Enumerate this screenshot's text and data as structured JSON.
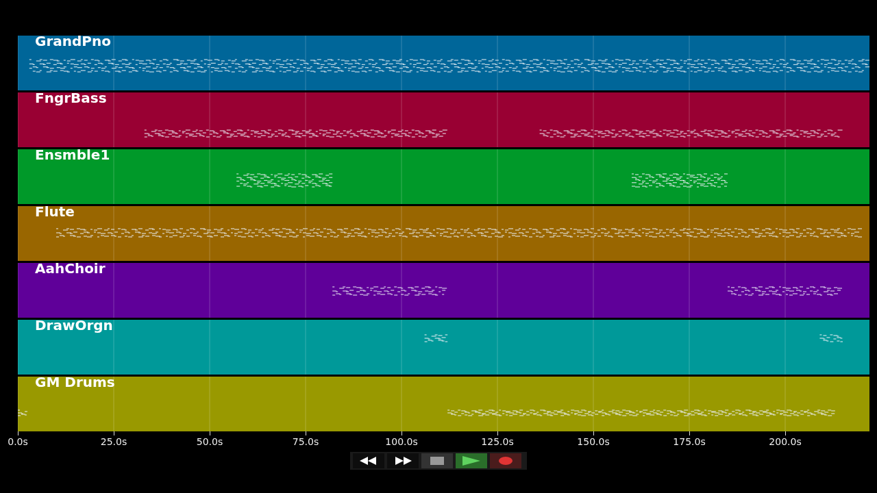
{
  "tracks": [
    {
      "name": "GrandPno",
      "color": "#006699"
    },
    {
      "name": "FngrBass",
      "color": "#990033"
    },
    {
      "name": "Ensmble1",
      "color": "#009929"
    },
    {
      "name": "Flute",
      "color": "#996600"
    },
    {
      "name": "AahChoir",
      "color": "#5f0099"
    },
    {
      "name": "DrawOrgn",
      "color": "#009999"
    },
    {
      "name": "GM Drums",
      "color": "#999900"
    }
  ],
  "time_axis": [
    "0.0s",
    "25.0s",
    "50.0s",
    "75.0s",
    "100.0s",
    "125.0s",
    "150.0s",
    "175.0s",
    "200.0s"
  ],
  "transport": [
    {
      "kind": "rewind"
    },
    {
      "kind": "forward"
    },
    {
      "kind": "stop"
    },
    {
      "kind": "play"
    },
    {
      "kind": "record"
    }
  ]
}
